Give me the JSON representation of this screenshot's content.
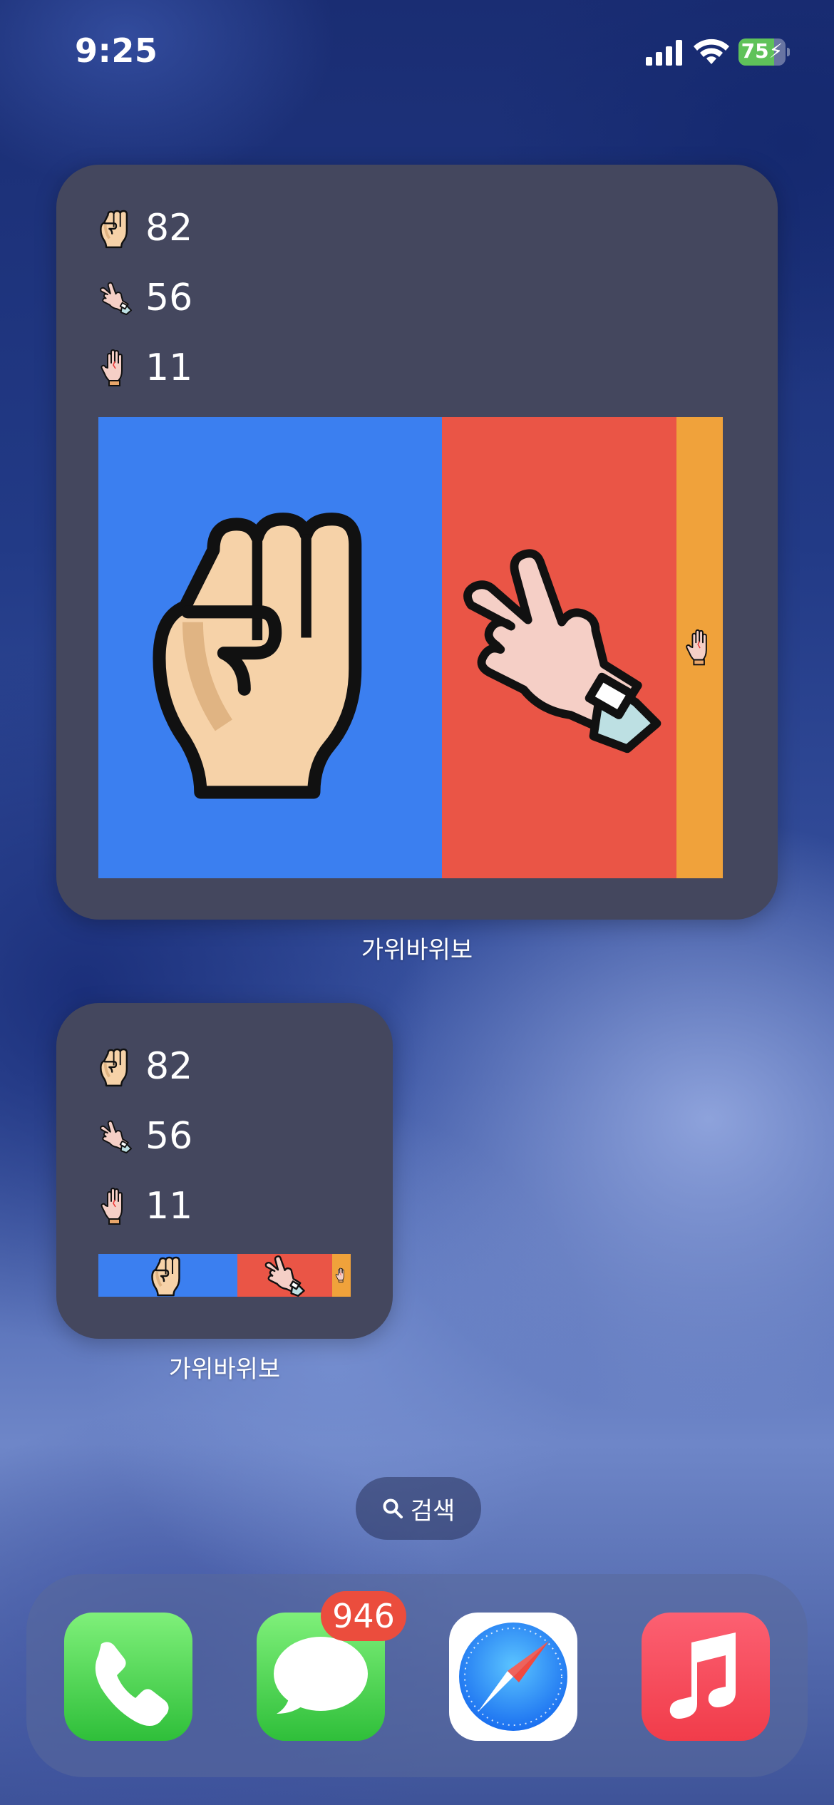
{
  "status_bar": {
    "time": "9:25",
    "battery_percent": "75",
    "battery_level": 0.75,
    "charging": true
  },
  "widgets": [
    {
      "size": "large",
      "label": "가위바위보",
      "stats": [
        {
          "icon": "rock-fist-icon",
          "value": "82"
        },
        {
          "icon": "scissors-hand-icon",
          "value": "56"
        },
        {
          "icon": "paper-hand-icon",
          "value": "11"
        }
      ],
      "share": [
        {
          "icon": "rock-fist-icon",
          "value": 82,
          "color": "#3b7ff0"
        },
        {
          "icon": "scissors-hand-icon",
          "value": 56,
          "color": "#ea5546"
        },
        {
          "icon": "paper-hand-icon",
          "value": 11,
          "color": "#f0a23b"
        }
      ]
    },
    {
      "size": "small",
      "label": "가위바위보",
      "stats": [
        {
          "icon": "rock-fist-icon",
          "value": "82"
        },
        {
          "icon": "scissors-hand-icon",
          "value": "56"
        },
        {
          "icon": "paper-hand-icon",
          "value": "11"
        }
      ],
      "share": [
        {
          "icon": "rock-fist-icon",
          "value": 82,
          "color": "#3b7ff0"
        },
        {
          "icon": "scissors-hand-icon",
          "value": 56,
          "color": "#ea5546"
        },
        {
          "icon": "paper-hand-icon",
          "value": 11,
          "color": "#f0a23b"
        }
      ]
    }
  ],
  "search": {
    "label": "검색"
  },
  "dock": {
    "apps": [
      {
        "name": "phone-app-icon",
        "color": "#4cd964"
      },
      {
        "name": "messages-app-icon",
        "color": "#4cd964",
        "badge": "946"
      },
      {
        "name": "safari-app-icon",
        "color": "#ffffff"
      },
      {
        "name": "music-app-icon",
        "color": "#fa3c4c"
      }
    ]
  },
  "colors": {
    "widget_bg": "#44475e",
    "rock": "#3b7ff0",
    "scissors": "#ea5546",
    "paper": "#f0a23b",
    "badge": "#eb4d3d"
  }
}
